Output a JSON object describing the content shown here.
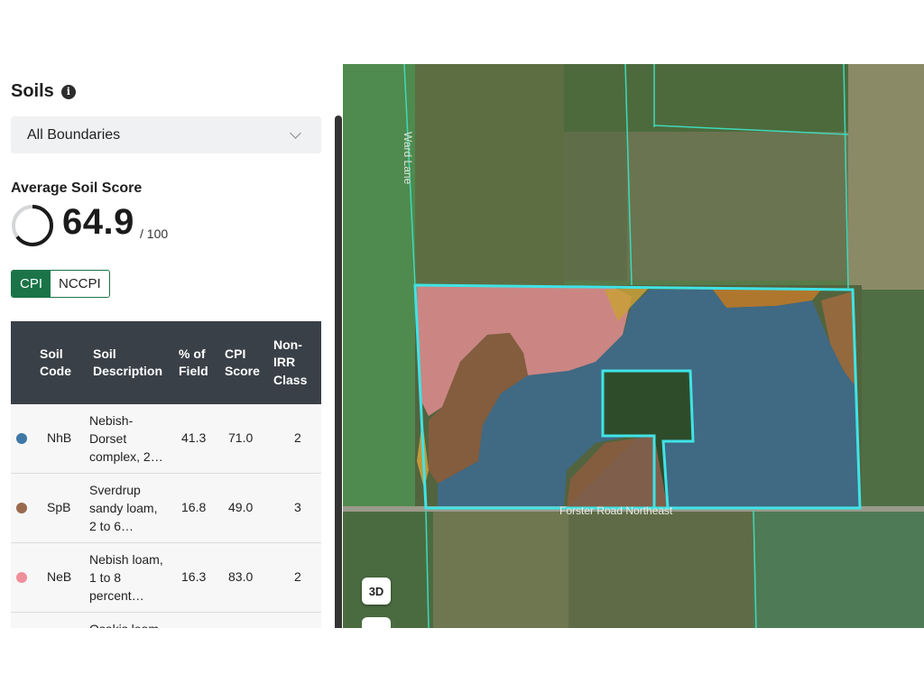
{
  "panel": {
    "title": "Soils",
    "info_icon": "info-icon",
    "boundary_select": {
      "value": "All Boundaries"
    },
    "average_label": "Average Soil Score",
    "score": "64.9",
    "score_max": "/ 100",
    "score_fraction": 0.649,
    "toggle": {
      "cpi": "CPI",
      "nccpi": "NCCPI",
      "active": "CPI"
    },
    "accent_color": "#1a7448",
    "table": {
      "headers": {
        "code": [
          "Soil",
          "Code"
        ],
        "desc": [
          "Soil",
          "Description"
        ],
        "pct": [
          "% of",
          "Field"
        ],
        "cpi": [
          "CPI",
          "Score"
        ],
        "irr": [
          "Non-",
          "IRR",
          "Class"
        ]
      },
      "rows": [
        {
          "color": "#3e78a6",
          "code": "NhB",
          "desc": [
            "Nebish-",
            "Dorset",
            "complex, 2…"
          ],
          "pct": "41.3",
          "cpi": "71.0",
          "irr": "2"
        },
        {
          "color": "#9a6a4e",
          "code": "SpB",
          "desc": [
            "Sverdrup",
            "sandy loam,",
            "2 to 6…"
          ],
          "pct": "16.8",
          "cpi": "49.0",
          "irr": "3"
        },
        {
          "color": "#ef8f99",
          "code": "NeB",
          "desc": [
            "Nebish loam,",
            "1 to 8",
            "percent…"
          ],
          "pct": "16.3",
          "cpi": "83.0",
          "irr": "2"
        },
        {
          "color": "#d4a23a",
          "code": "",
          "desc": [
            "Osakis loam,"
          ],
          "pct": "",
          "cpi": "",
          "irr": ""
        }
      ]
    }
  },
  "map": {
    "road_left": "Ward Lane",
    "road_bottom": "Forster Road Northeast",
    "btn_3d": "3D",
    "layers_icon": "layers-icon"
  }
}
